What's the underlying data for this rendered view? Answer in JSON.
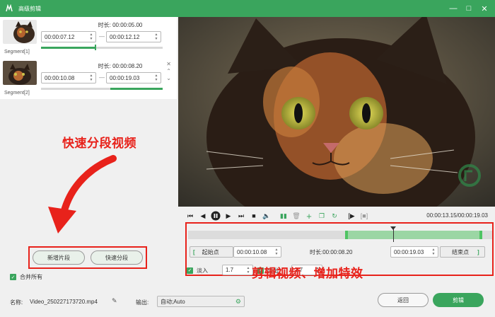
{
  "window": {
    "title": "高级剪辑"
  },
  "segments": [
    {
      "label": "Segment[1]",
      "duration_label": "时长:",
      "duration": "00:00:05.00",
      "start": "00:00:07.12",
      "end": "00:00:12.12"
    },
    {
      "label": "Segment[2]",
      "duration_label": "时长:",
      "duration": "00:00:08.20",
      "start": "00:00:10.08",
      "end": "00:00:19.03"
    }
  ],
  "annotations": {
    "left": "快速分段视频",
    "right": "剪辑视频、增加特效"
  },
  "buttons": {
    "add_segment": "新增片段",
    "quick_split": "快速分段",
    "back": "返回",
    "edit": "剪辑"
  },
  "merge_all": "合并所有",
  "player": {
    "timecode": "00:00:13.15/00:00:19.03"
  },
  "editor": {
    "start_label": "起始点",
    "start_value": "00:00:10.08",
    "duration_label": "时长:",
    "duration_value": "00:00:08.20",
    "end_value": "00:00:19.03",
    "end_label": "结束点",
    "fade_in_label": "淡入",
    "fade_in_value": "1.7",
    "fade_out_label": "淡出",
    "fade_out_value": "1.7",
    "selection_fraction": [
      0.55,
      1.0
    ],
    "playhead_fraction": 0.69
  },
  "file": {
    "name_label": "名称:",
    "name_value": "Video_250227173720.mp4",
    "output_label": "输出:",
    "output_value": "自动;Auto"
  },
  "colors": {
    "accent": "#3aa55d",
    "annotation": "#e8221b"
  },
  "icons": [
    "app-logo-icon",
    "minimize-icon",
    "maximize-icon",
    "close-icon",
    "pencil-icon",
    "gear-icon",
    "arrow-icon"
  ]
}
